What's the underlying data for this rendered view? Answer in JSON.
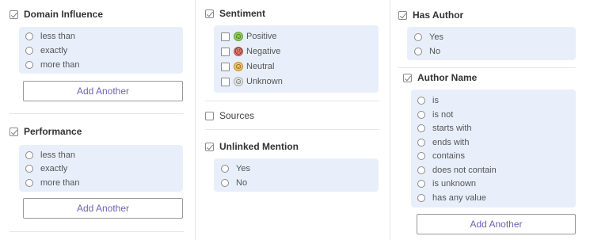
{
  "domain_influence": {
    "label": "Domain Influence",
    "options": [
      "less than",
      "exactly",
      "more than"
    ],
    "add_label": "Add Another"
  },
  "performance": {
    "label": "Performance",
    "options": [
      "less than",
      "exactly",
      "more than"
    ],
    "add_label": "Add Another"
  },
  "sentiment": {
    "label": "Sentiment",
    "options": [
      {
        "label": "Positive",
        "icon": "smiley-positive-icon",
        "color": "#8fd14f",
        "glyph": "☺"
      },
      {
        "label": "Negative",
        "icon": "smiley-negative-icon",
        "color": "#f07b6e",
        "glyph": "☹"
      },
      {
        "label": "Neutral",
        "icon": "smiley-neutral-icon",
        "color": "#f5c25a",
        "glyph": "☺"
      },
      {
        "label": "Unknown",
        "icon": "smiley-unknown-icon",
        "color": "#e4e4e4",
        "glyph": "☺"
      }
    ]
  },
  "sources": {
    "label": "Sources"
  },
  "unlinked_mention": {
    "label": "Unlinked Mention",
    "options": [
      "Yes",
      "No"
    ]
  },
  "has_author": {
    "label": "Has Author",
    "options": [
      "Yes",
      "No"
    ]
  },
  "author_name": {
    "label": "Author Name",
    "options": [
      "is",
      "is not",
      "starts with",
      "ends with",
      "contains",
      "does not contain",
      "is unknown",
      "has any value"
    ],
    "add_label": "Add Another"
  },
  "colors": {
    "panel": "#e8effb",
    "accent": "#6b63b5"
  }
}
